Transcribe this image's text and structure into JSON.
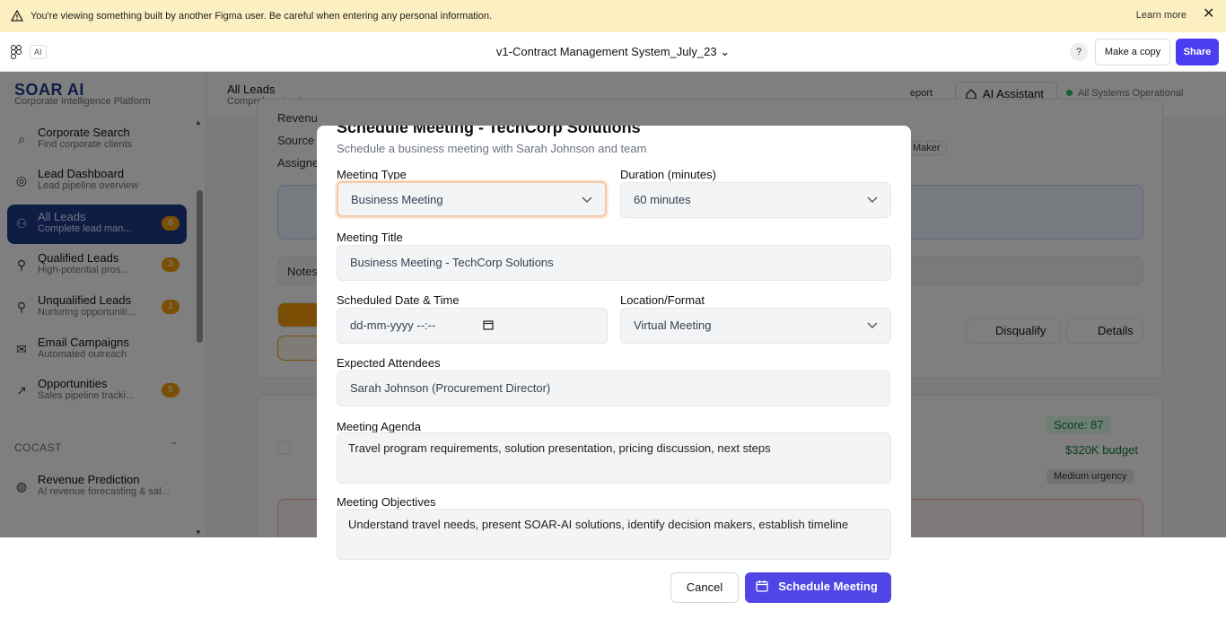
{
  "banner": {
    "message": "You're viewing something built by another Figma user. Be careful when entering any personal information.",
    "learn_more": "Learn more"
  },
  "figma": {
    "ai_badge": "AI",
    "file_title": "v1-Contract Management System_July_23",
    "help": "?",
    "make_copy": "Make a copy",
    "share": "Share"
  },
  "sidebar": {
    "brand": "SOAR AI",
    "tagline": "Corporate Intelligence Platform",
    "items": [
      {
        "label": "Corporate Search",
        "sub": "Find corporate clients",
        "badge": ""
      },
      {
        "label": "Lead Dashboard",
        "sub": "Lead pipeline overview",
        "badge": ""
      },
      {
        "label": "All Leads",
        "sub": "Complete lead man...",
        "badge": "6"
      },
      {
        "label": "Qualified Leads",
        "sub": "High-potential pros...",
        "badge": "3"
      },
      {
        "label": "Unqualified Leads",
        "sub": "Nurturing opportuniti...",
        "badge": "1"
      },
      {
        "label": "Email Campaigns",
        "sub": "Automated outreach",
        "badge": ""
      },
      {
        "label": "Opportunities",
        "sub": "Sales pipeline tracki...",
        "badge": "5"
      }
    ],
    "section": "COCAST",
    "cocast_items": [
      {
        "label": "Revenue Prediction",
        "sub": "AI revenue forecasting & sal..."
      }
    ]
  },
  "topbar": {
    "title": "All Leads",
    "subtitle": "Comprehensive le",
    "report": "eport",
    "ai_assistant": "AI Assistant",
    "status": "All Systems Operational"
  },
  "background": {
    "revenue": "Revenu",
    "source": "Source",
    "assigned": "Assigne",
    "maker": "Maker",
    "notes": "Notes",
    "disqualify": "Disqualify",
    "details": "Details",
    "score": "Score: 87",
    "budget": "$320K budget",
    "urgency": "Medium urgency"
  },
  "modal": {
    "title": "Schedule Meeting - TechCorp Solutions",
    "description": "Schedule a business meeting with Sarah Johnson and team",
    "meeting_type_label": "Meeting Type",
    "meeting_type_value": "Business Meeting",
    "duration_label": "Duration (minutes)",
    "duration_value": "60 minutes",
    "meeting_title_label": "Meeting Title",
    "meeting_title_value": "Business Meeting - TechCorp Solutions",
    "datetime_label": "Scheduled Date & Time",
    "datetime_placeholder": "dd-mm-yyyy --:--",
    "location_label": "Location/Format",
    "location_value": "Virtual Meeting",
    "attendees_label": "Expected Attendees",
    "attendees_value": "Sarah Johnson (Procurement Director)",
    "agenda_label": "Meeting Agenda",
    "agenda_value": "Travel program requirements, solution presentation, pricing discussion, next steps",
    "objectives_label": "Meeting Objectives",
    "objectives_value": "Understand travel needs, present SOAR-AI solutions, identify decision makers, establish timeline",
    "cancel": "Cancel",
    "schedule": "Schedule Meeting"
  },
  "colors": {
    "brand": "#1e3a8a",
    "primary_button": "#4f46e5",
    "badge": "#f59e0b",
    "banner_bg": "#fcefc1",
    "focus_ring": "#f3c8a8"
  }
}
